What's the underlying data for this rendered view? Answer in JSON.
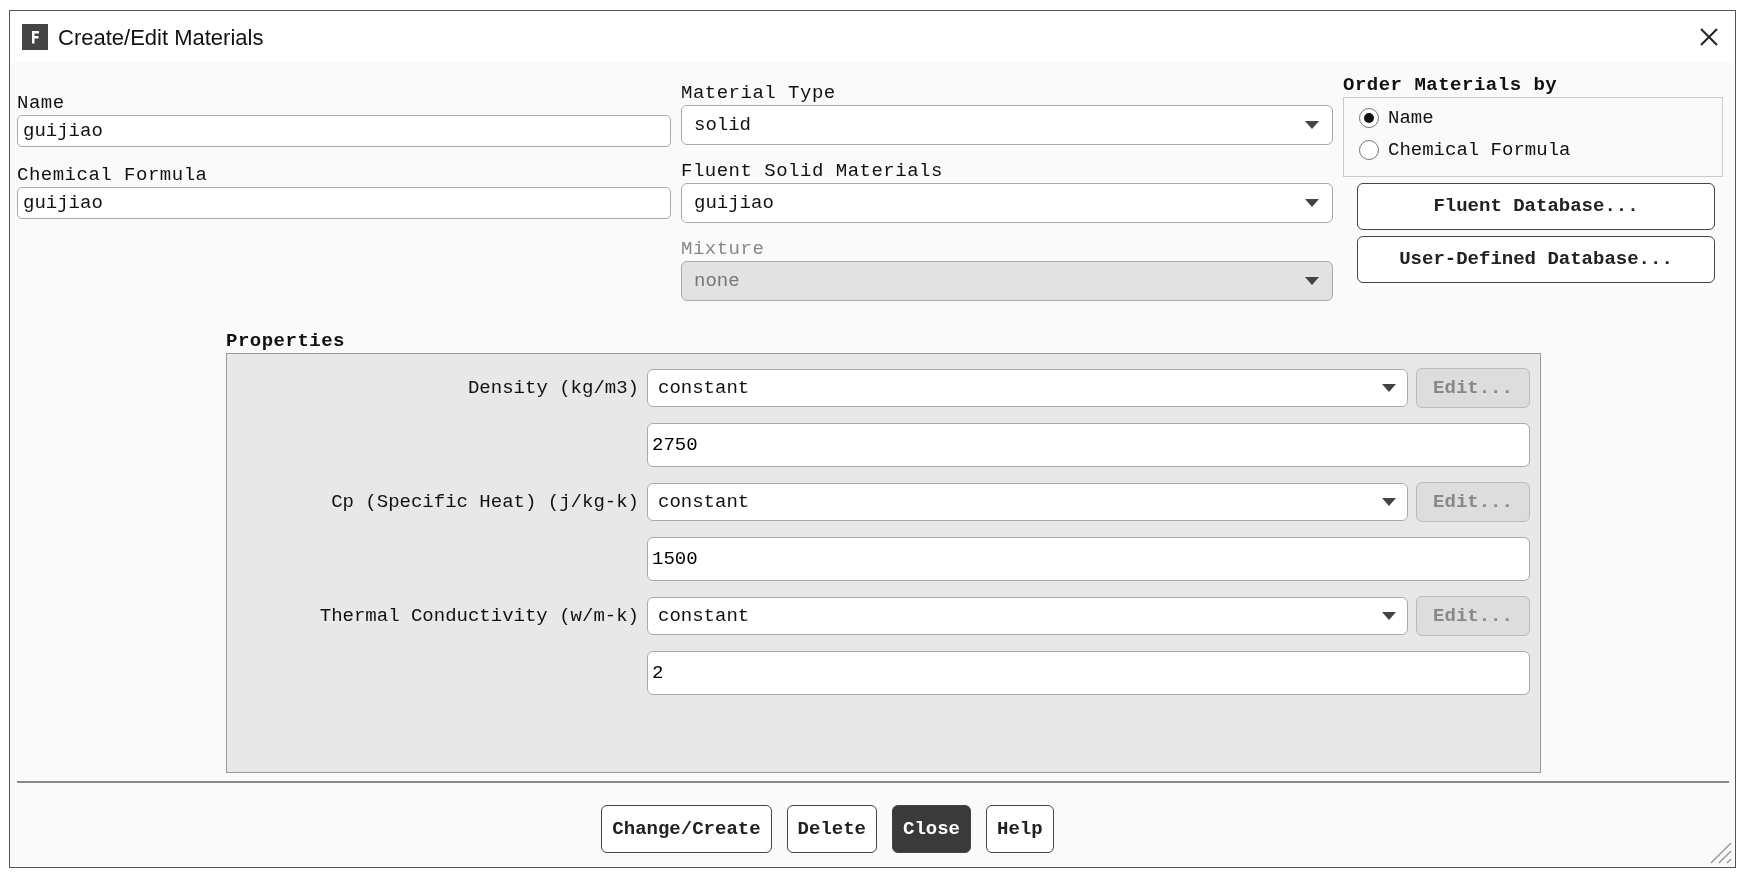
{
  "window": {
    "title": "Create/Edit Materials"
  },
  "text_fields": [
    {
      "label": "Name",
      "value": "guijiao"
    },
    {
      "label": "Chemical Formula",
      "value": "guijiao"
    }
  ],
  "dropdowns": [
    {
      "label": "Material Type",
      "value": "solid",
      "disabled": false
    },
    {
      "label": "Fluent Solid Materials",
      "value": "guijiao",
      "disabled": false
    },
    {
      "label": "Mixture",
      "value": "none",
      "disabled": true
    }
  ],
  "order_by": {
    "label": "Order Materials by",
    "options": [
      {
        "label": "Name",
        "selected": true
      },
      {
        "label": "Chemical Formula",
        "selected": false
      }
    ]
  },
  "database_buttons": [
    "Fluent Database...",
    "User-Defined Database..."
  ],
  "properties": {
    "label": "Properties",
    "rows": [
      {
        "label": "Density (kg/m3)",
        "method": "constant",
        "edit": "Edit...",
        "edit_disabled": true,
        "value": "2750"
      },
      {
        "label": "Cp (Specific Heat) (j/kg-k)",
        "method": "constant",
        "edit": "Edit...",
        "edit_disabled": true,
        "value": "1500"
      },
      {
        "label": "Thermal Conductivity (w/m-k)",
        "method": "constant",
        "edit": "Edit...",
        "edit_disabled": true,
        "value": "2"
      }
    ]
  },
  "buttons": [
    {
      "label": "Change/Create",
      "primary": false
    },
    {
      "label": "Delete",
      "primary": false
    },
    {
      "label": "Close",
      "primary": true
    },
    {
      "label": "Help",
      "primary": false
    }
  ]
}
